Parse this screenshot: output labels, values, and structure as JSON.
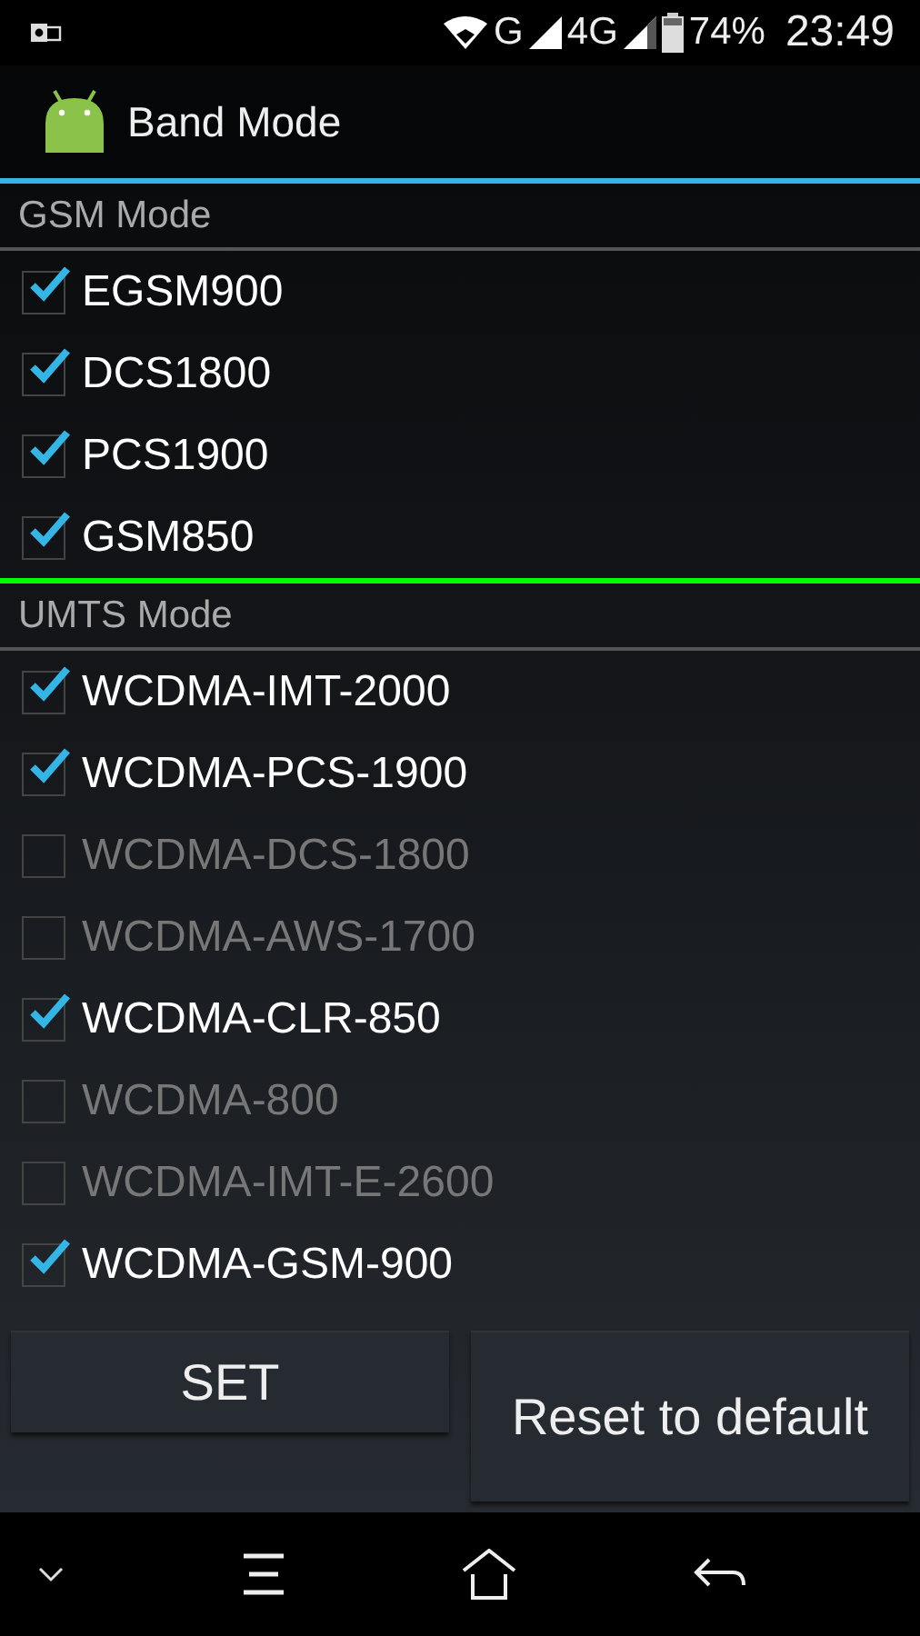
{
  "status_bar": {
    "network_1": "G",
    "network_2": "4G",
    "battery": "74%",
    "time": "23:49"
  },
  "app_bar": {
    "title": "Band Mode"
  },
  "sections": [
    {
      "title": "GSM Mode",
      "color": "#33b5e5",
      "items": [
        {
          "label": "EGSM900",
          "checked": true
        },
        {
          "label": "DCS1800",
          "checked": true
        },
        {
          "label": "PCS1900",
          "checked": true
        },
        {
          "label": "GSM850",
          "checked": true
        }
      ]
    },
    {
      "title": "UMTS Mode",
      "color": "#00ff00",
      "items": [
        {
          "label": "WCDMA-IMT-2000",
          "checked": true
        },
        {
          "label": "WCDMA-PCS-1900",
          "checked": true
        },
        {
          "label": "WCDMA-DCS-1800",
          "checked": false
        },
        {
          "label": "WCDMA-AWS-1700",
          "checked": false
        },
        {
          "label": "WCDMA-CLR-850",
          "checked": true
        },
        {
          "label": "WCDMA-800",
          "checked": false
        },
        {
          "label": "WCDMA-IMT-E-2600",
          "checked": false
        },
        {
          "label": "WCDMA-GSM-900",
          "checked": true
        }
      ]
    }
  ],
  "buttons": [
    "SET",
    "Reset to default"
  ]
}
